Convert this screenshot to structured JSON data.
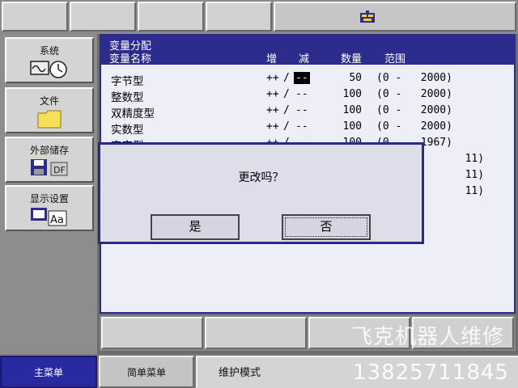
{
  "toolbar": {
    "icon": "robot-logo-icon"
  },
  "sidebar": {
    "items": [
      {
        "label": "系统",
        "icon": "system-icon"
      },
      {
        "label": "文件",
        "icon": "folder-icon"
      },
      {
        "label": "外部储存",
        "icon": "external-storage-icon"
      },
      {
        "label": "显示设置",
        "icon": "display-settings-icon"
      }
    ]
  },
  "window": {
    "title": "变量分配",
    "headers": {
      "name": "变量名称",
      "inc": "增",
      "dec": "减",
      "count": "数量",
      "range": "范围"
    },
    "rows": [
      {
        "name": "字节型",
        "inc": "++",
        "sep": "/",
        "dec": "--",
        "count": "50",
        "range": "(0 -   2000)"
      },
      {
        "name": "整数型",
        "inc": "++",
        "sep": "/",
        "dec": "--",
        "count": "100",
        "range": "(0 -   2000)"
      },
      {
        "name": "双精度型",
        "inc": "++",
        "sep": "/",
        "dec": "--",
        "count": "100",
        "range": "(0 -   2000)"
      },
      {
        "name": "实数型",
        "inc": "++",
        "sep": "/",
        "dec": "--",
        "count": "100",
        "range": "(0 -   2000)"
      },
      {
        "name": "字字型",
        "inc": "++",
        "sep": "/",
        "dec": "--",
        "count": "100",
        "range": "(0 -   1967)"
      },
      {
        "name": "",
        "inc": "",
        "sep": "",
        "dec": "",
        "count": "",
        "range": "              11)"
      },
      {
        "name": "",
        "inc": "",
        "sep": "",
        "dec": "",
        "count": "",
        "range": "              11)"
      },
      {
        "name": "",
        "inc": "",
        "sep": "",
        "dec": "",
        "count": "",
        "range": "              11)"
      }
    ]
  },
  "dialog": {
    "message": "更改吗？",
    "yes": "是",
    "no": "否"
  },
  "bottombar": {
    "main_menu": "主菜单",
    "simple_menu": "简单菜单",
    "mode": "维护模式"
  },
  "watermark": {
    "line1": "飞克机器人维修",
    "line2": "13825711845"
  },
  "colors": {
    "accent": "#2c2c8c",
    "window_bg": "#eeeef8",
    "panel": "#8d8d8d"
  }
}
